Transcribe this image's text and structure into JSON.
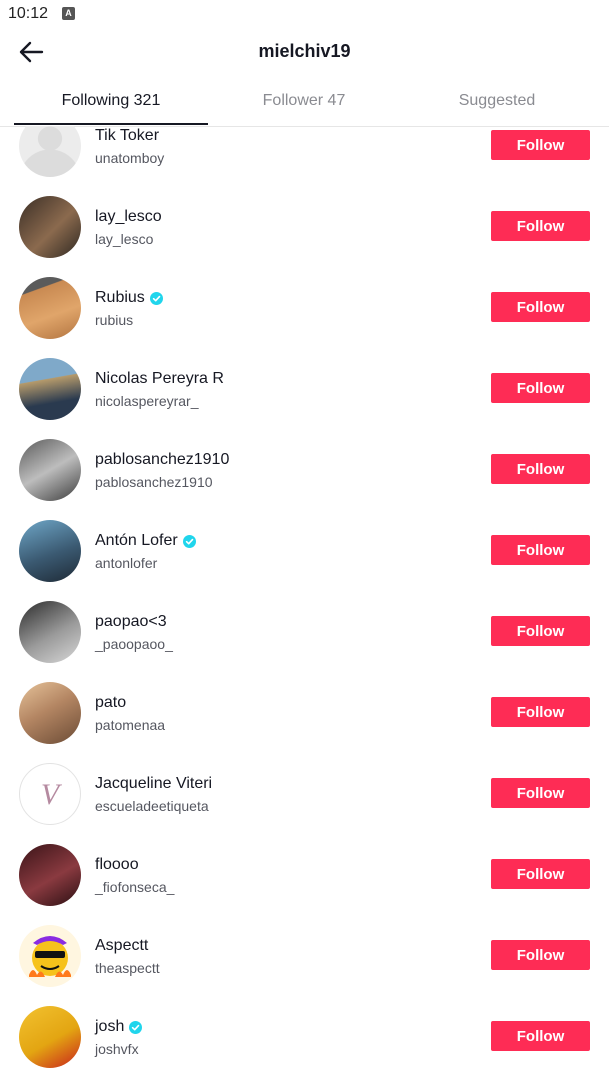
{
  "status": {
    "time": "10:12",
    "notif_icon": "a-app-icon"
  },
  "header": {
    "title": "mielchiv19",
    "back_icon": "arrow-left-icon"
  },
  "tabs": [
    {
      "label": "Following 321",
      "active": true
    },
    {
      "label": "Follower 47",
      "active": false
    },
    {
      "label": "Suggested",
      "active": false
    }
  ],
  "follow_label": "Follow",
  "users": [
    {
      "name": "Tik Toker",
      "handle": "unatomboy",
      "verified": false,
      "avatar": "default-avatar"
    },
    {
      "name": "lay_lesco",
      "handle": "lay_lesco",
      "verified": false,
      "avatar": "photo-avatar"
    },
    {
      "name": "Rubius",
      "handle": "rubius",
      "verified": true,
      "avatar": "photo-avatar"
    },
    {
      "name": "Nicolas Pereyra R",
      "handle": "nicolaspereyrar_",
      "verified": false,
      "avatar": "photo-avatar"
    },
    {
      "name": "pablosanchez1910",
      "handle": "pablosanchez1910",
      "verified": false,
      "avatar": "photo-avatar"
    },
    {
      "name": "Antón Lofer",
      "handle": "antonlofer",
      "verified": true,
      "avatar": "photo-avatar"
    },
    {
      "name": "paopao<3",
      "handle": "_paoopaoo_",
      "verified": false,
      "avatar": "photo-avatar"
    },
    {
      "name": "pato",
      "handle": "patomenaa",
      "verified": false,
      "avatar": "photo-avatar"
    },
    {
      "name": "Jacqueline Viteri",
      "handle": "escueladeetiqueta",
      "verified": false,
      "avatar": "logo-avatar"
    },
    {
      "name": "floooo",
      "handle": "_fiofonseca_",
      "verified": false,
      "avatar": "photo-avatar"
    },
    {
      "name": "Aspectt",
      "handle": "theaspectt",
      "verified": false,
      "avatar": "cartoon-avatar"
    },
    {
      "name": "josh",
      "handle": "joshvfx",
      "verified": true,
      "avatar": "photo-avatar"
    }
  ],
  "colors": {
    "accent": "#fe2c55",
    "verified": "#20d5ec",
    "text_primary": "#161823",
    "text_secondary": "#555760"
  }
}
